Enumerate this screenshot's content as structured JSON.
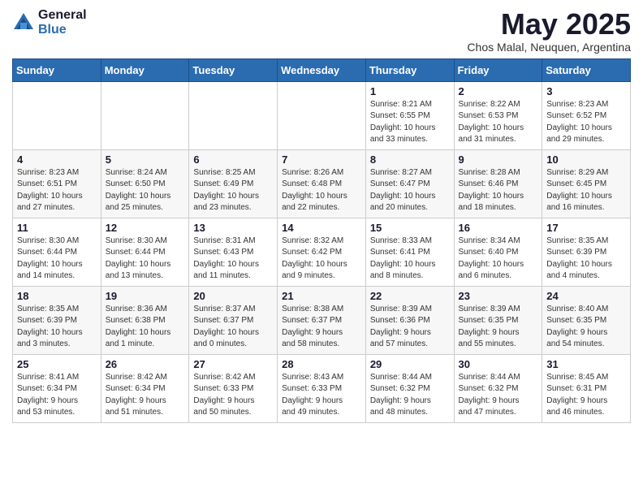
{
  "logo": {
    "general": "General",
    "blue": "Blue"
  },
  "title": "May 2025",
  "subtitle": "Chos Malal, Neuquen, Argentina",
  "days_of_week": [
    "Sunday",
    "Monday",
    "Tuesday",
    "Wednesday",
    "Thursday",
    "Friday",
    "Saturday"
  ],
  "weeks": [
    [
      {
        "day": "",
        "info": ""
      },
      {
        "day": "",
        "info": ""
      },
      {
        "day": "",
        "info": ""
      },
      {
        "day": "",
        "info": ""
      },
      {
        "day": "1",
        "info": "Sunrise: 8:21 AM\nSunset: 6:55 PM\nDaylight: 10 hours\nand 33 minutes."
      },
      {
        "day": "2",
        "info": "Sunrise: 8:22 AM\nSunset: 6:53 PM\nDaylight: 10 hours\nand 31 minutes."
      },
      {
        "day": "3",
        "info": "Sunrise: 8:23 AM\nSunset: 6:52 PM\nDaylight: 10 hours\nand 29 minutes."
      }
    ],
    [
      {
        "day": "4",
        "info": "Sunrise: 8:23 AM\nSunset: 6:51 PM\nDaylight: 10 hours\nand 27 minutes."
      },
      {
        "day": "5",
        "info": "Sunrise: 8:24 AM\nSunset: 6:50 PM\nDaylight: 10 hours\nand 25 minutes."
      },
      {
        "day": "6",
        "info": "Sunrise: 8:25 AM\nSunset: 6:49 PM\nDaylight: 10 hours\nand 23 minutes."
      },
      {
        "day": "7",
        "info": "Sunrise: 8:26 AM\nSunset: 6:48 PM\nDaylight: 10 hours\nand 22 minutes."
      },
      {
        "day": "8",
        "info": "Sunrise: 8:27 AM\nSunset: 6:47 PM\nDaylight: 10 hours\nand 20 minutes."
      },
      {
        "day": "9",
        "info": "Sunrise: 8:28 AM\nSunset: 6:46 PM\nDaylight: 10 hours\nand 18 minutes."
      },
      {
        "day": "10",
        "info": "Sunrise: 8:29 AM\nSunset: 6:45 PM\nDaylight: 10 hours\nand 16 minutes."
      }
    ],
    [
      {
        "day": "11",
        "info": "Sunrise: 8:30 AM\nSunset: 6:44 PM\nDaylight: 10 hours\nand 14 minutes."
      },
      {
        "day": "12",
        "info": "Sunrise: 8:30 AM\nSunset: 6:44 PM\nDaylight: 10 hours\nand 13 minutes."
      },
      {
        "day": "13",
        "info": "Sunrise: 8:31 AM\nSunset: 6:43 PM\nDaylight: 10 hours\nand 11 minutes."
      },
      {
        "day": "14",
        "info": "Sunrise: 8:32 AM\nSunset: 6:42 PM\nDaylight: 10 hours\nand 9 minutes."
      },
      {
        "day": "15",
        "info": "Sunrise: 8:33 AM\nSunset: 6:41 PM\nDaylight: 10 hours\nand 8 minutes."
      },
      {
        "day": "16",
        "info": "Sunrise: 8:34 AM\nSunset: 6:40 PM\nDaylight: 10 hours\nand 6 minutes."
      },
      {
        "day": "17",
        "info": "Sunrise: 8:35 AM\nSunset: 6:39 PM\nDaylight: 10 hours\nand 4 minutes."
      }
    ],
    [
      {
        "day": "18",
        "info": "Sunrise: 8:35 AM\nSunset: 6:39 PM\nDaylight: 10 hours\nand 3 minutes."
      },
      {
        "day": "19",
        "info": "Sunrise: 8:36 AM\nSunset: 6:38 PM\nDaylight: 10 hours\nand 1 minute."
      },
      {
        "day": "20",
        "info": "Sunrise: 8:37 AM\nSunset: 6:37 PM\nDaylight: 10 hours\nand 0 minutes."
      },
      {
        "day": "21",
        "info": "Sunrise: 8:38 AM\nSunset: 6:37 PM\nDaylight: 9 hours\nand 58 minutes."
      },
      {
        "day": "22",
        "info": "Sunrise: 8:39 AM\nSunset: 6:36 PM\nDaylight: 9 hours\nand 57 minutes."
      },
      {
        "day": "23",
        "info": "Sunrise: 8:39 AM\nSunset: 6:35 PM\nDaylight: 9 hours\nand 55 minutes."
      },
      {
        "day": "24",
        "info": "Sunrise: 8:40 AM\nSunset: 6:35 PM\nDaylight: 9 hours\nand 54 minutes."
      }
    ],
    [
      {
        "day": "25",
        "info": "Sunrise: 8:41 AM\nSunset: 6:34 PM\nDaylight: 9 hours\nand 53 minutes."
      },
      {
        "day": "26",
        "info": "Sunrise: 8:42 AM\nSunset: 6:34 PM\nDaylight: 9 hours\nand 51 minutes."
      },
      {
        "day": "27",
        "info": "Sunrise: 8:42 AM\nSunset: 6:33 PM\nDaylight: 9 hours\nand 50 minutes."
      },
      {
        "day": "28",
        "info": "Sunrise: 8:43 AM\nSunset: 6:33 PM\nDaylight: 9 hours\nand 49 minutes."
      },
      {
        "day": "29",
        "info": "Sunrise: 8:44 AM\nSunset: 6:32 PM\nDaylight: 9 hours\nand 48 minutes."
      },
      {
        "day": "30",
        "info": "Sunrise: 8:44 AM\nSunset: 6:32 PM\nDaylight: 9 hours\nand 47 minutes."
      },
      {
        "day": "31",
        "info": "Sunrise: 8:45 AM\nSunset: 6:31 PM\nDaylight: 9 hours\nand 46 minutes."
      }
    ]
  ]
}
